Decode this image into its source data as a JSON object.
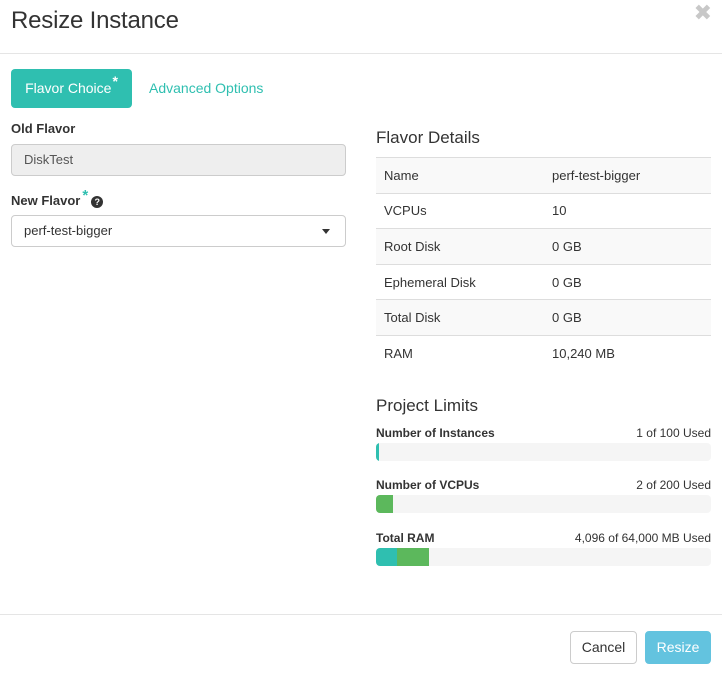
{
  "modal": {
    "title": "Resize Instance",
    "close_glyph": "✖"
  },
  "tabs": [
    {
      "label": "Flavor Choice",
      "required_mark": "*",
      "active": true
    },
    {
      "label": "Advanced Options",
      "active": false
    }
  ],
  "form": {
    "old_flavor_label": "Old Flavor",
    "old_flavor_value": "DiskTest",
    "new_flavor_label": "New Flavor",
    "new_flavor_required_mark": "*",
    "new_flavor_help_glyph": "?",
    "new_flavor_selected": "perf-test-bigger"
  },
  "flavor_details": {
    "title": "Flavor Details",
    "rows": [
      {
        "key": "Name",
        "value": "perf-test-bigger"
      },
      {
        "key": "VCPUs",
        "value": "10"
      },
      {
        "key": "Root Disk",
        "value": "0 GB"
      },
      {
        "key": "Ephemeral Disk",
        "value": "0 GB"
      },
      {
        "key": "Total Disk",
        "value": "0 GB"
      },
      {
        "key": "RAM",
        "value": "10,240 MB"
      }
    ]
  },
  "project_limits": {
    "title": "Project Limits",
    "items": [
      {
        "name": "Number of Instances",
        "used_text": "1 of 100 Used",
        "used_fraction": 0.01,
        "added_fraction": 0.0,
        "used_color": "#2fbfb0",
        "added_color": "#5cb85c"
      },
      {
        "name": "Number of VCPUs",
        "used_text": "2 of 200 Used",
        "used_fraction": 0.0,
        "added_fraction": 0.05,
        "used_color": "#2fbfb0",
        "added_color": "#5cb85c"
      },
      {
        "name": "Total RAM",
        "used_text": "4,096 of 64,000 MB Used",
        "used_fraction": 0.064,
        "added_fraction": 0.096,
        "used_color": "#2fbfb0",
        "added_color": "#5cb85c"
      }
    ]
  },
  "footer": {
    "cancel_label": "Cancel",
    "resize_label": "Resize"
  },
  "colors": {
    "accent": "#2fbfb0",
    "primary_button": "#5bc0de"
  }
}
